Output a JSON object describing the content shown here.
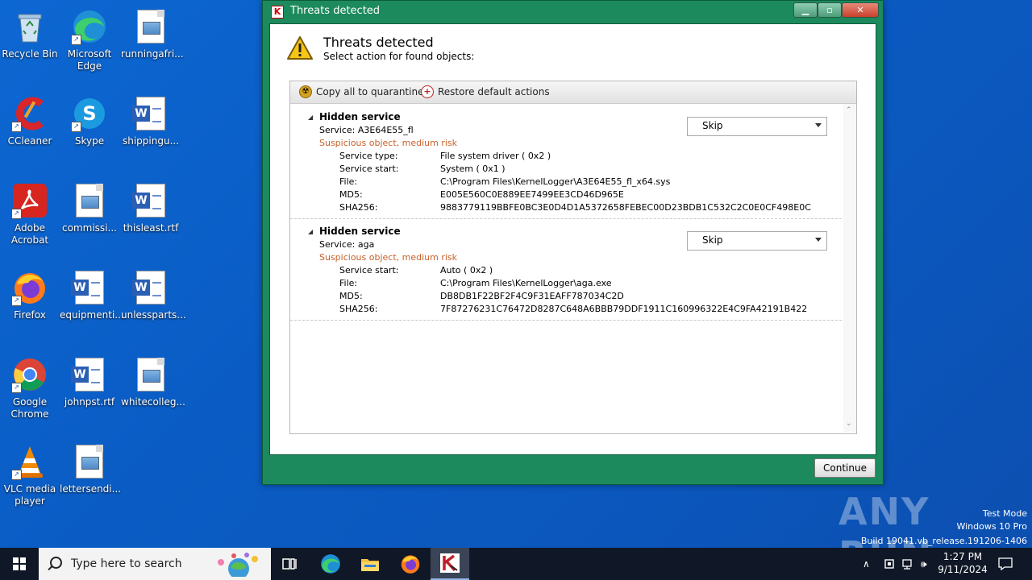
{
  "desktop": {
    "icons": [
      {
        "label": "Recycle Bin",
        "icon": "recycle-bin-icon"
      },
      {
        "label": "Microsoft Edge",
        "icon": "edge-icon"
      },
      {
        "label": "runningafri...",
        "icon": "image-file-icon"
      },
      {
        "label": "CCleaner",
        "icon": "ccleaner-icon"
      },
      {
        "label": "Skype",
        "icon": "skype-icon"
      },
      {
        "label": "shippingu...",
        "icon": "word-file-icon"
      },
      {
        "label": "Adobe Acrobat",
        "icon": "acrobat-icon"
      },
      {
        "label": "commissi...",
        "icon": "image-file-icon"
      },
      {
        "label": "thisleast.rtf",
        "icon": "word-file-icon"
      },
      {
        "label": "Firefox",
        "icon": "firefox-icon"
      },
      {
        "label": "equipmenti...",
        "icon": "word-file-icon"
      },
      {
        "label": "unlessparts...",
        "icon": "word-file-icon"
      },
      {
        "label": "Google Chrome",
        "icon": "chrome-icon"
      },
      {
        "label": "johnpst.rtf",
        "icon": "word-file-icon"
      },
      {
        "label": "whitecolleg...",
        "icon": "image-file-icon"
      },
      {
        "label": "VLC media player",
        "icon": "vlc-icon"
      },
      {
        "label": "lettersendi...",
        "icon": "image-file-icon"
      }
    ]
  },
  "window": {
    "title": "Threats detected",
    "heading": "Threats detected",
    "subheading": "Select action for found objects:",
    "toolbar": {
      "quarantine_label": "Copy all to quarantine",
      "restore_label": "Restore default actions"
    },
    "threats": [
      {
        "type": "Hidden service",
        "service": "Service: A3E64E55_fl",
        "risk": "Suspicious object, medium risk",
        "action": "Skip",
        "details": [
          {
            "key": "Service type:",
            "value": "File system driver ( 0x2 )"
          },
          {
            "key": "Service start:",
            "value": "System ( 0x1 )"
          },
          {
            "key": "File:",
            "value": "C:\\Program Files\\KernelLogger\\A3E64E55_fl_x64.sys"
          },
          {
            "key": "MD5:",
            "value": "E005E560C0E889EE7499EE3CD46D965E"
          },
          {
            "key": "SHA256:",
            "value": "9883779119BBFE0BC3E0D4D1A5372658FEBEC00D23BDB1C532C2C0E0CF498E0C"
          }
        ]
      },
      {
        "type": "Hidden service",
        "service": "Service: aga",
        "risk": "Suspicious object, medium risk",
        "action": "Skip",
        "details": [
          {
            "key": "Service start:",
            "value": "Auto ( 0x2 )"
          },
          {
            "key": "File:",
            "value": "C:\\Program Files\\KernelLogger\\aga.exe"
          },
          {
            "key": "MD5:",
            "value": "DB8DB1F22BF2F4C9F31EAFF787034C2D"
          },
          {
            "key": "SHA256:",
            "value": "7F87276231C76472D8287C648A6BBB79DDF1911C160996322E4C9FA42191B422"
          }
        ]
      }
    ],
    "continue_label": "Continue"
  },
  "watermark": {
    "brand": "ANY RUN",
    "line1": "Test Mode",
    "line2": "Windows 10 Pro",
    "line3": "Build 19041.vb_release.191206-1406"
  },
  "taskbar": {
    "search_placeholder": "Type here to search",
    "time": "1:27 PM",
    "date": "9/11/2024"
  },
  "colors": {
    "window_frame": "#1c8a5c",
    "risk_text": "#c8602a",
    "desktop": "#0a63c9",
    "taskbar": "#101827"
  }
}
